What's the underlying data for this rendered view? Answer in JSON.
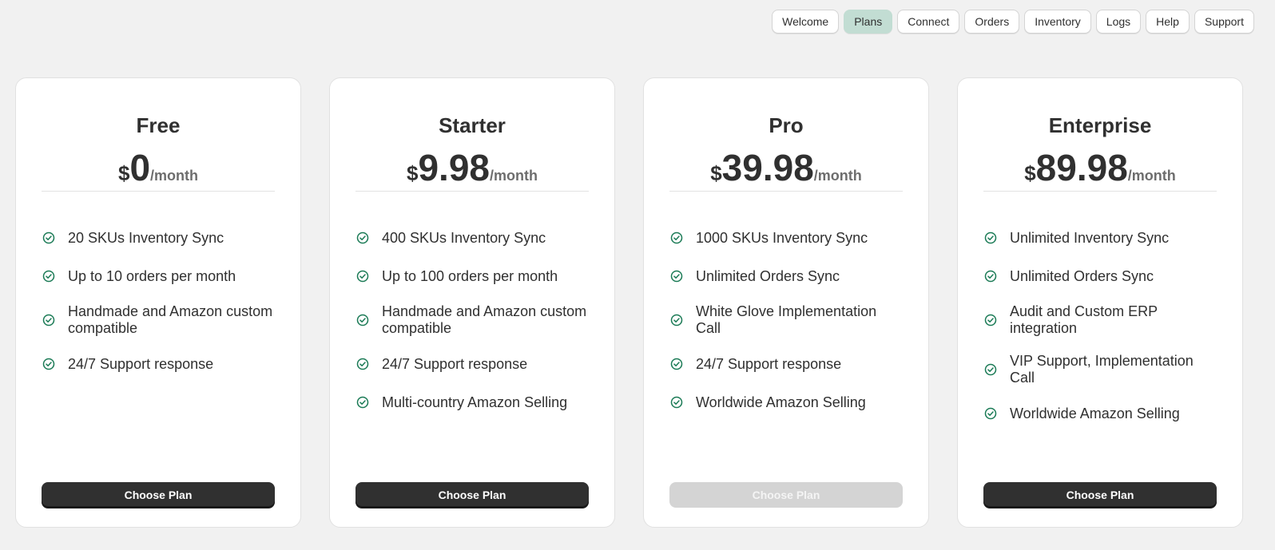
{
  "nav": {
    "items": [
      {
        "label": "Welcome",
        "active": false
      },
      {
        "label": "Plans",
        "active": true
      },
      {
        "label": "Connect",
        "active": false
      },
      {
        "label": "Orders",
        "active": false
      },
      {
        "label": "Inventory",
        "active": false
      },
      {
        "label": "Logs",
        "active": false
      },
      {
        "label": "Help",
        "active": false
      },
      {
        "label": "Support",
        "active": false
      }
    ]
  },
  "colors": {
    "accent_active_tab": "#c2ddd3",
    "check_green": "#1a7a55",
    "button_dark": "#303030",
    "button_disabled": "#d4d4d4"
  },
  "plans": [
    {
      "name": "Free",
      "currency": "$",
      "amount": "0",
      "period": "/month",
      "features": [
        "20 SKUs Inventory Sync",
        "Up to 10 orders per month",
        "Handmade and Amazon custom compatible",
        "24/7 Support response"
      ],
      "button_label": "Choose Plan",
      "button_disabled": false
    },
    {
      "name": "Starter",
      "currency": "$",
      "amount": "9.98",
      "period": "/month",
      "features": [
        "400 SKUs Inventory Sync",
        "Up to 100 orders per month",
        "Handmade and Amazon custom compatible",
        "24/7 Support response",
        "Multi-country Amazon Selling"
      ],
      "button_label": "Choose Plan",
      "button_disabled": false
    },
    {
      "name": "Pro",
      "currency": "$",
      "amount": "39.98",
      "period": "/month",
      "features": [
        "1000 SKUs Inventory Sync",
        "Unlimited Orders Sync",
        "White Glove Implementation Call",
        "24/7 Support response",
        "Worldwide Amazon Selling"
      ],
      "button_label": "Choose Plan",
      "button_disabled": true
    },
    {
      "name": "Enterprise",
      "currency": "$",
      "amount": "89.98",
      "period": "/month",
      "features": [
        "Unlimited Inventory Sync",
        "Unlimited Orders Sync",
        "Audit and Custom ERP integration",
        "VIP Support, Implementation Call",
        "Worldwide Amazon Selling"
      ],
      "button_label": "Choose Plan",
      "button_disabled": false
    }
  ]
}
